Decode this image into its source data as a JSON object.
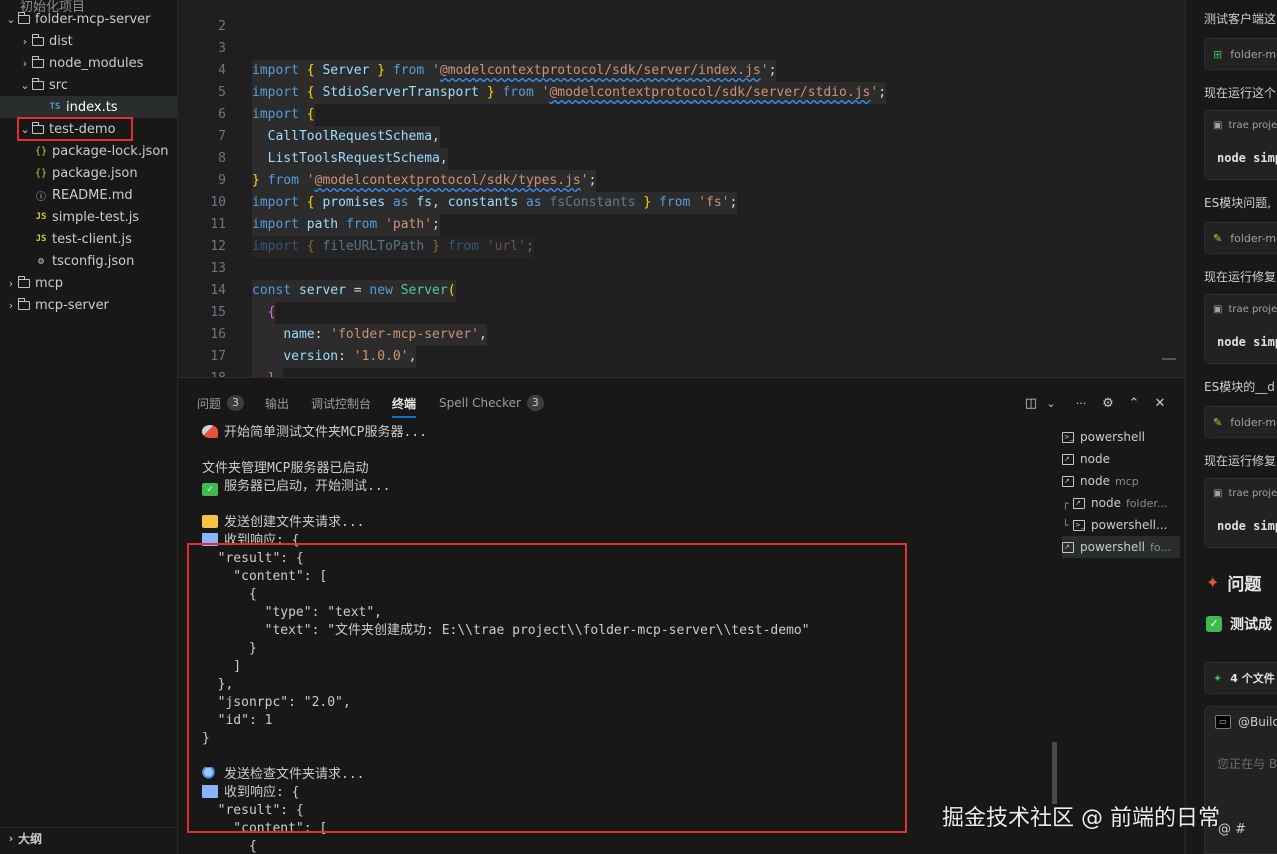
{
  "explorer": {
    "root_label_partial": "初始化项目",
    "items": [
      {
        "label": "folder-mcp-server",
        "type": "folder",
        "expanded": true
      },
      {
        "label": "dist",
        "type": "folder",
        "expanded": false
      },
      {
        "label": "node_modules",
        "type": "folder",
        "expanded": false
      },
      {
        "label": "src",
        "type": "folder",
        "expanded": true
      },
      {
        "label": "index.ts",
        "type": "ts",
        "icon_text": "TS"
      },
      {
        "label": "test-demo",
        "type": "folder",
        "expanded": true
      },
      {
        "label": "package-lock.json",
        "type": "json",
        "icon_text": "{}"
      },
      {
        "label": "package.json",
        "type": "json",
        "icon_text": "{}"
      },
      {
        "label": "README.md",
        "type": "info",
        "icon_text": "ⓘ"
      },
      {
        "label": "simple-test.js",
        "type": "js",
        "icon_text": "JS"
      },
      {
        "label": "test-client.js",
        "type": "js",
        "icon_text": "JS"
      },
      {
        "label": "tsconfig.json",
        "type": "gear",
        "icon_text": "⚙"
      },
      {
        "label": "mcp",
        "type": "folder",
        "expanded": false
      },
      {
        "label": "mcp-server",
        "type": "folder",
        "expanded": false
      }
    ],
    "outline_label": "大纲"
  },
  "editor": {
    "line_numbers": [
      "2",
      "3",
      "4",
      "5",
      "6",
      "7",
      "8",
      "9",
      "10",
      "11",
      "12",
      "13",
      "14",
      "15",
      "16",
      "17",
      "18"
    ],
    "lines": {
      "l3": {
        "kw": "import",
        "ob": "{",
        "name": "Server",
        "cb": "}",
        "from": "from",
        "q1": "'",
        "src": "@modelcontextprotocol/sdk/server/index.js",
        "q2": "'",
        "end": ";"
      },
      "l4": {
        "kw": "import",
        "ob": "{",
        "name": "StdioServerTransport",
        "cb": "}",
        "from": "from",
        "q1": "'",
        "src": "@modelcontextprotocol/sdk/server/stdio.js",
        "q2": "'",
        "end": ";"
      },
      "l5": {
        "kw": "import",
        "ob": "{"
      },
      "l6": {
        "name": "CallToolRequestSchema",
        "end": ","
      },
      "l7": {
        "name": "ListToolsRequestSchema",
        "end": ","
      },
      "l8": {
        "cb": "}",
        "from": "from",
        "q1": "'",
        "src": "@modelcontextprotocol/sdk/types.js",
        "q2": "'",
        "end": ";"
      },
      "l9": {
        "kw": "import",
        "ob": "{",
        "a": "promises",
        "as1": "as",
        "b": "fs",
        "comma": ",",
        "c": "constants",
        "as2": "as",
        "d": "fsConstants",
        "cb": "}",
        "from": "from",
        "src": "'fs'",
        "end": ";"
      },
      "l10": {
        "kw": "import",
        "name": "path",
        "from": "from",
        "src": "'path'",
        "end": ";"
      },
      "l11": {
        "kw": "import",
        "ob": "{",
        "name": "fileURLToPath",
        "cb": "}",
        "from": "from",
        "src": "'url'",
        "end": ";"
      },
      "l13": {
        "kw": "const",
        "name": "server",
        "eq": "=",
        "kw2": "new",
        "cls": "Server",
        "paren": "("
      },
      "l14": {
        "brace": "{"
      },
      "l15": {
        "key": "name",
        "colon": ":",
        "val": "'folder-mcp-server'",
        "end": ","
      },
      "l16": {
        "key": "version",
        "colon": ":",
        "val": "'1.0.0'",
        "end": ","
      },
      "l17": {
        "brace": "},"
      },
      "l18": {
        "brace": "{"
      }
    }
  },
  "panel": {
    "tabs": [
      {
        "label": "问题",
        "badge": "3"
      },
      {
        "label": "输出"
      },
      {
        "label": "调试控制台"
      },
      {
        "label": "终端",
        "active": true
      },
      {
        "label": "Spell Checker",
        "badge": "3"
      }
    ],
    "controls": [
      "split-icon",
      "chevron-down-icon",
      "more-icon",
      "settings-icon",
      "maximize-icon",
      "close-icon"
    ],
    "control_glyphs": {
      "split": "◫",
      "chevron": "⌄",
      "more": "···",
      "settings": "⚙",
      "max": "⌃",
      "close": "✕"
    }
  },
  "terminal": {
    "lines": [
      "开始简单测试文件夹MCP服务器...",
      "",
      "文件夹管理MCP服务器已启动",
      "服务器已启动，开始测试...",
      "",
      "发送创建文件夹请求...",
      "收到响应: {",
      "  \"result\": {",
      "    \"content\": [",
      "      {",
      "        \"type\": \"text\",",
      "        \"text\": \"文件夹创建成功: E:\\\\trae project\\\\folder-mcp-server\\\\test-demo\"",
      "      }",
      "    ]",
      "  },",
      "  \"jsonrpc\": \"2.0\",",
      "  \"id\": 1",
      "}",
      "",
      "发送检查文件夹请求...",
      "收到响应: {",
      "  \"result\": {",
      "    \"content\": [",
      "      {"
    ],
    "sessions": [
      {
        "name": "powershell",
        "sub": ""
      },
      {
        "name": "node",
        "sub": ""
      },
      {
        "name": "node",
        "sub": "mcp"
      },
      {
        "name": "node",
        "sub": "folder..."
      },
      {
        "name": "powershell...",
        "sub": ""
      },
      {
        "name": "powershell",
        "sub": "fo...",
        "active": true
      }
    ]
  },
  "chat": {
    "items": [
      {
        "kind": "text",
        "text": "测试客户端这"
      },
      {
        "kind": "card",
        "text": "folder-m"
      },
      {
        "kind": "text",
        "text": "现在运行这个"
      },
      {
        "kind": "cmd",
        "hdr": "trae proje",
        "cmd": "node simp"
      },
      {
        "kind": "text",
        "text": "ES模块问题,"
      },
      {
        "kind": "card",
        "text": "folder-m"
      },
      {
        "kind": "text",
        "text": "现在运行修复"
      },
      {
        "kind": "cmd",
        "hdr": "trae proje",
        "cmd": "node simp"
      },
      {
        "kind": "text",
        "text": "ES模块的__d"
      },
      {
        "kind": "card",
        "text": "folder-m"
      },
      {
        "kind": "text",
        "text": "现在运行修复"
      },
      {
        "kind": "cmd",
        "hdr": "trae proje",
        "cmd": "node simp"
      }
    ],
    "heading": "问题",
    "success": "测试成",
    "files_card": "4 个文件",
    "input_mention": "@Build",
    "input_placeholder": "您正在与 B",
    "mention_icons": "@  #"
  },
  "watermark": "掘金技术社区 @ 前端的日常",
  "colors": {
    "highlight": "#e0302a",
    "accent": "#0078d4",
    "success": "#3fb950"
  }
}
